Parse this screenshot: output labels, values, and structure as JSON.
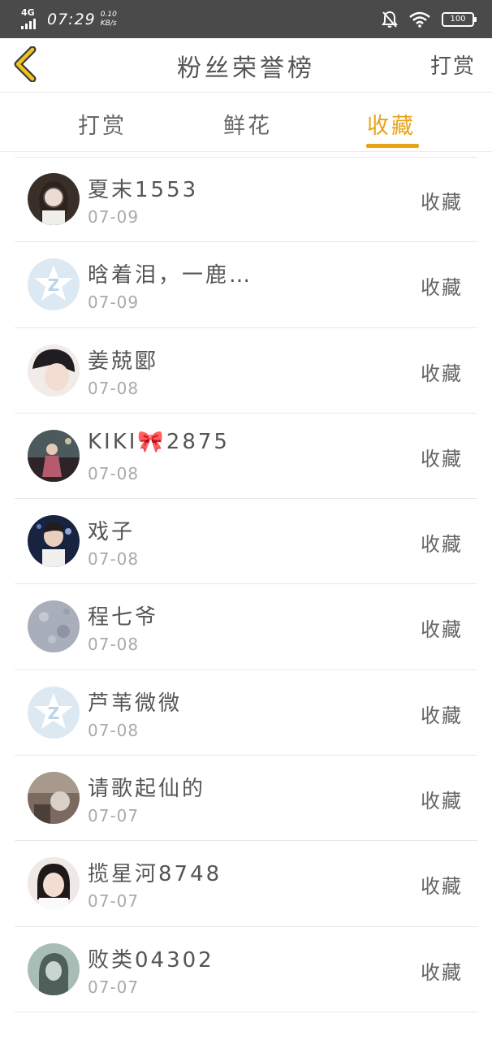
{
  "status_bar": {
    "network": "4G",
    "time": "07:29",
    "speed_value": "0.10",
    "speed_unit": "KB/s",
    "battery": "100",
    "icons": [
      "bell-muted-icon",
      "wifi-icon",
      "battery-icon"
    ]
  },
  "header": {
    "title": "粉丝荣誉榜",
    "action_label": "打赏",
    "back_icon": "chevron-left-icon",
    "accent": "#e8a317"
  },
  "tabs": [
    {
      "label": "打赏",
      "active": false
    },
    {
      "label": "鲜花",
      "active": false
    },
    {
      "label": "收藏",
      "active": true
    }
  ],
  "rows": [
    {
      "name": "夏末1553",
      "date": "07-09",
      "action": "收藏",
      "avatar": "photo"
    },
    {
      "name": "晗着泪，一鹿…",
      "date": "07-09",
      "action": "收藏",
      "avatar": "qq-default-icon"
    },
    {
      "name": "姜兢郾",
      "date": "07-08",
      "action": "收藏",
      "avatar": "photo"
    },
    {
      "name": "KIKI🎀2875",
      "date": "07-08",
      "action": "收藏",
      "avatar": "photo"
    },
    {
      "name": "戏子",
      "date": "07-08",
      "action": "收藏",
      "avatar": "photo"
    },
    {
      "name": "程七爷",
      "date": "07-08",
      "action": "收藏",
      "avatar": "photo"
    },
    {
      "name": "芦苇微微",
      "date": "07-08",
      "action": "收藏",
      "avatar": "qq-default-icon"
    },
    {
      "name": "请歌起仙的",
      "date": "07-07",
      "action": "收藏",
      "avatar": "photo"
    },
    {
      "name": "揽星河8748",
      "date": "07-07",
      "action": "收藏",
      "avatar": "photo"
    },
    {
      "name": "败类04302",
      "date": "07-07",
      "action": "收藏",
      "avatar": "photo"
    }
  ]
}
